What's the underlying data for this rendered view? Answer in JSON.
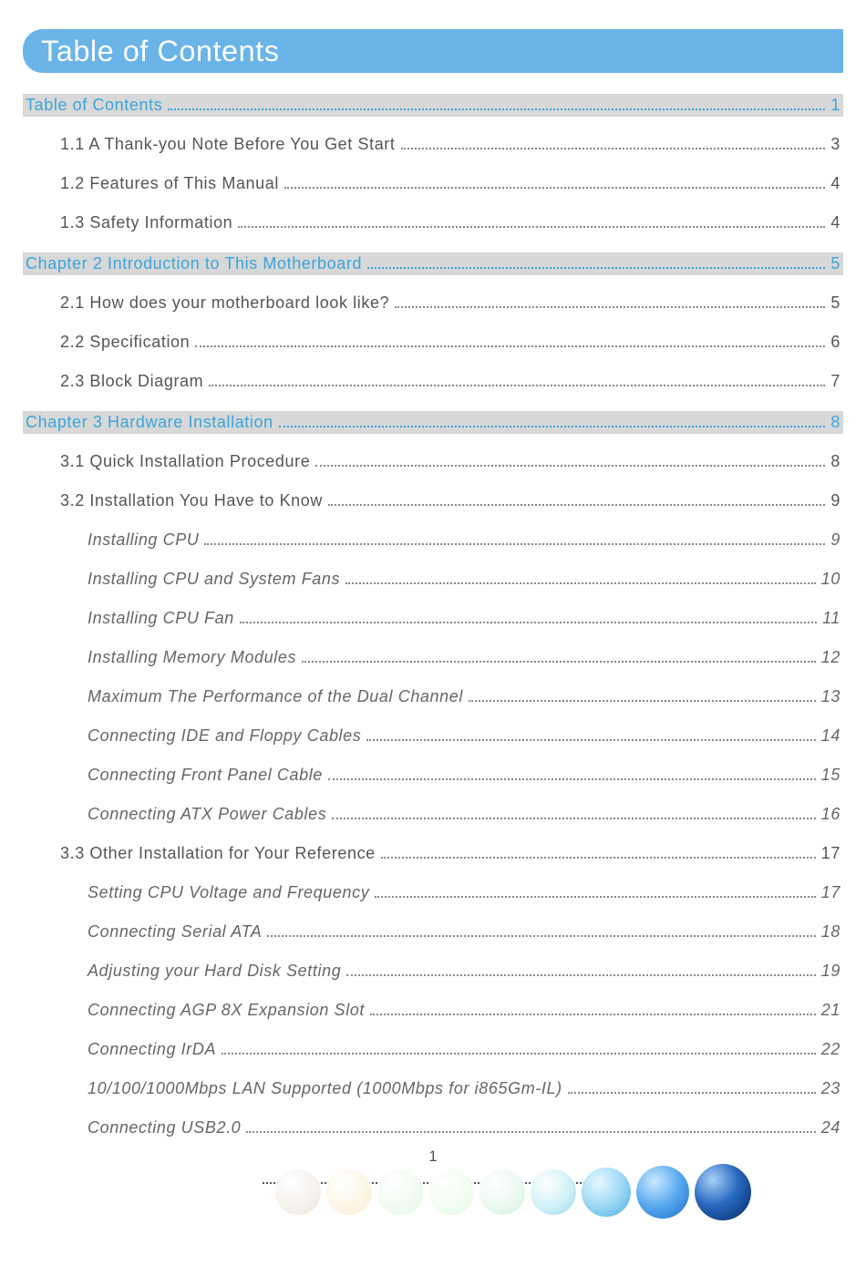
{
  "header": {
    "title": "Table of Contents"
  },
  "footer": {
    "page_number": "1"
  },
  "toc": [
    {
      "level": "chapter",
      "label": "Table of Contents",
      "page": "1"
    },
    {
      "level": "section",
      "label": "1.1 A Thank-you Note Before You Get Start",
      "page": "3"
    },
    {
      "level": "section",
      "label": "1.2 Features of This Manual",
      "page": "4"
    },
    {
      "level": "section",
      "label": "1.3 Safety Information",
      "page": "4"
    },
    {
      "level": "chapter",
      "label": "Chapter 2 Introduction to This Motherboard",
      "page": "5"
    },
    {
      "level": "section",
      "label": "2.1 How does your motherboard look like?",
      "page": "5"
    },
    {
      "level": "section",
      "label": "2.2 Specification",
      "page": "6"
    },
    {
      "level": "section",
      "label": "2.3 Block Diagram",
      "page": "7"
    },
    {
      "level": "chapter",
      "label": "Chapter 3 Hardware Installation",
      "page": "8"
    },
    {
      "level": "section",
      "label": "3.1 Quick Installation Procedure",
      "page": "8"
    },
    {
      "level": "section",
      "label": "3.2 Installation You Have to Know",
      "page": "9"
    },
    {
      "level": "subsection",
      "label": "Installing CPU",
      "page": "9"
    },
    {
      "level": "subsection",
      "label": "Installing CPU and System Fans",
      "page": "10"
    },
    {
      "level": "subsection",
      "label": "Installing CPU Fan",
      "page": "11"
    },
    {
      "level": "subsection",
      "label": "Installing Memory Modules",
      "page": "12"
    },
    {
      "level": "subsection",
      "label": "Maximum The Performance of the Dual Channel",
      "page": "13"
    },
    {
      "level": "subsection",
      "label": "Connecting IDE and Floppy Cables",
      "page": "14"
    },
    {
      "level": "subsection",
      "label": "Connecting Front Panel Cable",
      "page": "15"
    },
    {
      "level": "subsection",
      "label": "Connecting ATX Power Cables",
      "page": "16"
    },
    {
      "level": "section",
      "label": "3.3 Other Installation for Your Reference",
      "page": "17"
    },
    {
      "level": "subsection",
      "label": "Setting CPU Voltage and Frequency",
      "page": "17"
    },
    {
      "level": "subsection",
      "label": "Connecting Serial ATA",
      "page": "18"
    },
    {
      "level": "subsection",
      "label": "Adjusting your Hard Disk Setting",
      "page": "19"
    },
    {
      "level": "subsection",
      "label": "Connecting AGP 8X Expansion Slot",
      "page": "21"
    },
    {
      "level": "subsection",
      "label": "Connecting IrDA",
      "page": "22"
    },
    {
      "level": "subsection",
      "label": "10/100/1000Mbps LAN Supported (1000Mbps for i865Gm-IL)",
      "page": "23"
    },
    {
      "level": "subsection",
      "label": "Connecting USB2.0",
      "page": "24"
    }
  ]
}
